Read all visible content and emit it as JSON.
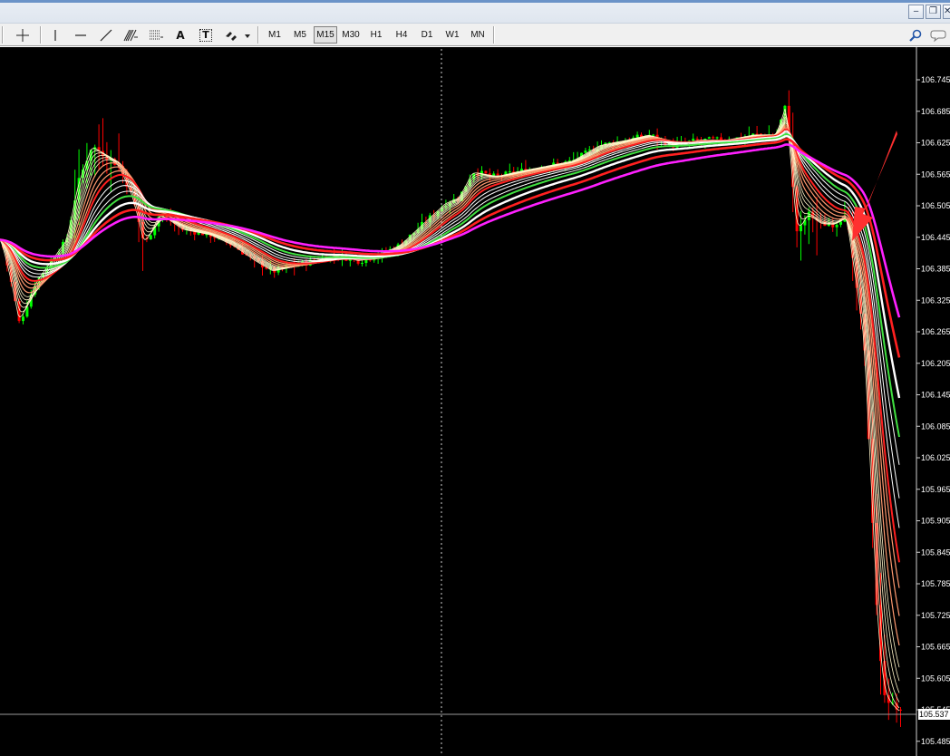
{
  "toolbar": {
    "timeframes": [
      "M1",
      "M5",
      "M15",
      "M30",
      "H1",
      "H4",
      "D1",
      "W1",
      "MN"
    ],
    "active_timeframe": "M15",
    "text_tool_a": "A",
    "text_label_tool": "T",
    "icons": [
      "crosshair-icon",
      "vertical-line-icon",
      "horizontal-line-icon",
      "trendline-icon",
      "fibonacci-icon",
      "gann-grid-icon",
      "text-icon",
      "text-label-icon",
      "arrows-icon",
      "search-icon",
      "chat-icon"
    ]
  },
  "window": {
    "minimize": "‒",
    "restore": "❐",
    "close": "✕"
  },
  "chart": {
    "price_ticks": [
      "106.745",
      "106.685",
      "106.625",
      "106.565",
      "106.505",
      "106.445",
      "106.385",
      "106.325",
      "106.265",
      "106.205",
      "106.145",
      "106.085",
      "106.025",
      "105.965",
      "105.905",
      "105.845",
      "105.785",
      "105.725",
      "105.665",
      "105.605",
      "105.545",
      "105.485"
    ],
    "current_price": "105.537",
    "price_range": [
      105.44,
      106.8
    ],
    "colors": {
      "background": "#000000",
      "bull_candle": "#00ff00",
      "bear_candle": "#ff0000",
      "ema_fast": "#fff4c8",
      "ema_mid": "#ff9a70",
      "ema_red": "#ff2020",
      "ema_green": "#40e040",
      "ema_white": "#ffffff",
      "ema_magenta": "#ff20ff",
      "arrow": "#ff3030"
    }
  }
}
